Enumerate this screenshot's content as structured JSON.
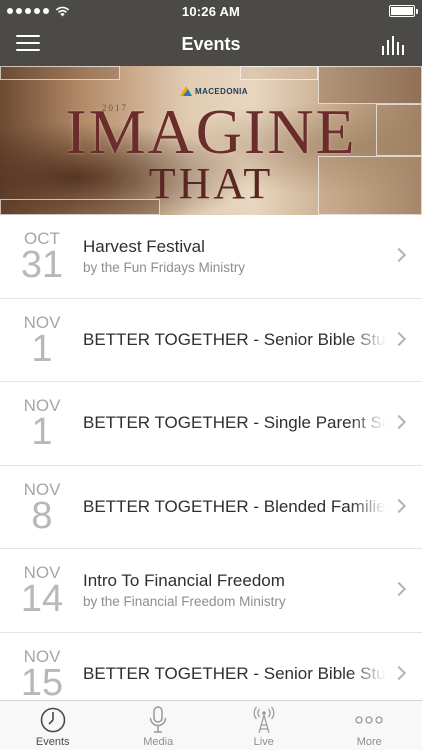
{
  "status_bar": {
    "time": "10:26 AM"
  },
  "nav": {
    "title": "Events",
    "menu_icon": "hamburger-icon",
    "right_icon": "equalizer-icon"
  },
  "banner": {
    "logo_text": "MACEDONIA",
    "year": "2017",
    "title": "IMAGINE",
    "subtitle": "THAT"
  },
  "events": [
    {
      "month": "OCT",
      "day": "31",
      "title": "Harvest Festival",
      "subtitle": "by the Fun Fridays Ministry"
    },
    {
      "month": "NOV",
      "day": "1",
      "title": "BETTER TOGETHER - Senior Bible Study",
      "subtitle": ""
    },
    {
      "month": "NOV",
      "day": "1",
      "title": "BETTER TOGETHER - Single Parent Sunday",
      "subtitle": ""
    },
    {
      "month": "NOV",
      "day": "8",
      "title": "BETTER TOGETHER - Blended Families",
      "subtitle": ""
    },
    {
      "month": "NOV",
      "day": "14",
      "title": "Intro To Financial Freedom",
      "subtitle": "by the Financial Freedom Ministry"
    },
    {
      "month": "NOV",
      "day": "15",
      "title": "BETTER TOGETHER - Senior Bible Study",
      "subtitle": ""
    }
  ],
  "tabs": [
    {
      "label": "Events",
      "icon": "clock-icon",
      "active": true
    },
    {
      "label": "Media",
      "icon": "microphone-icon",
      "active": false
    },
    {
      "label": "Live",
      "icon": "broadcast-tower-icon",
      "active": false
    },
    {
      "label": "More",
      "icon": "more-dots-icon",
      "active": false
    }
  ],
  "colors": {
    "bar": "#4b4a47",
    "text_dark": "#2f2f2f",
    "text_muted": "#8e8e8e",
    "date_gray": "#a6a6a6"
  }
}
